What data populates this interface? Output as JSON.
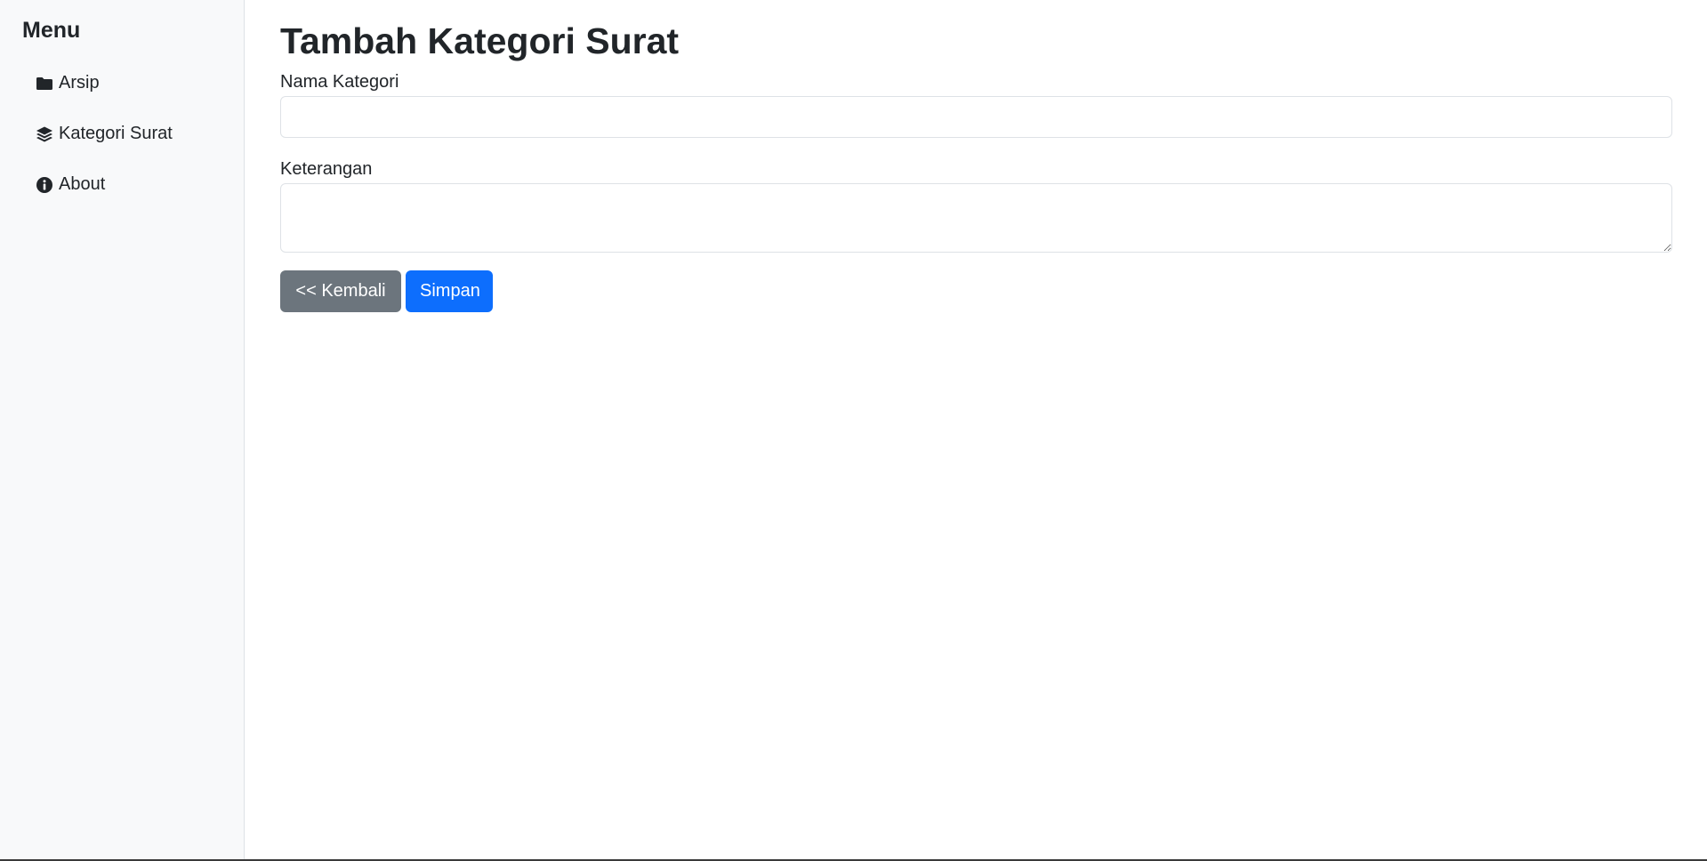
{
  "sidebar": {
    "title": "Menu",
    "items": [
      {
        "label": "Arsip",
        "icon": "folder-icon"
      },
      {
        "label": "Kategori Surat",
        "icon": "layers-icon"
      },
      {
        "label": "About",
        "icon": "info-circle-icon"
      }
    ]
  },
  "main": {
    "title": "Tambah Kategori Surat",
    "fields": {
      "nama_kategori": {
        "label": "Nama Kategori",
        "value": "",
        "placeholder": ""
      },
      "keterangan": {
        "label": "Keterangan",
        "value": "",
        "placeholder": ""
      }
    },
    "buttons": {
      "back_label": "<< Kembali",
      "save_label": "Simpan"
    }
  },
  "colors": {
    "sidebar_bg": "#f8f9fa",
    "primary": "#0d6efd",
    "secondary": "#6c757d",
    "text": "#212529",
    "border": "#dee2e6"
  }
}
